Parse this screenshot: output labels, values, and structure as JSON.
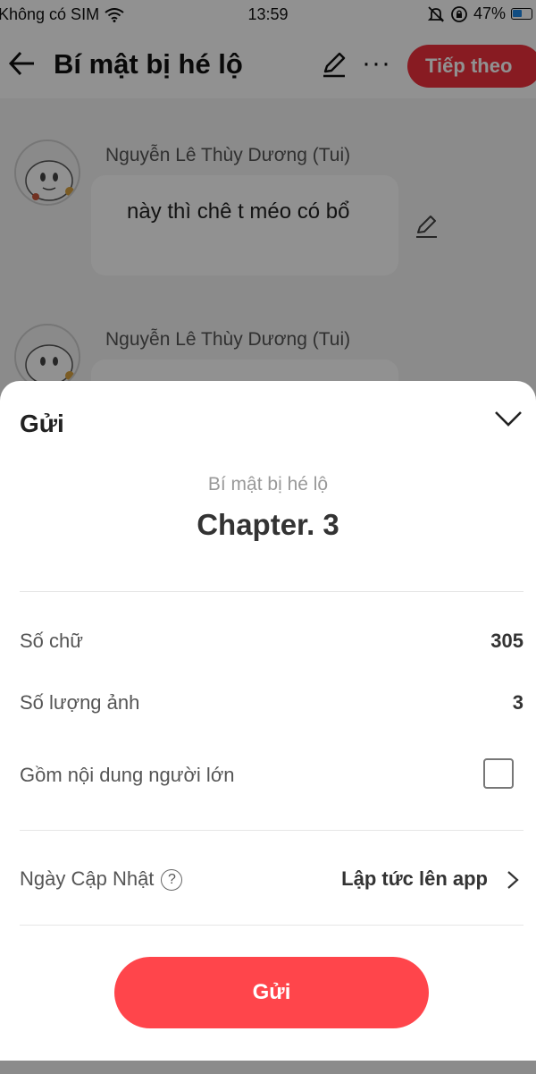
{
  "status_bar": {
    "carrier": "Không có SIM",
    "time": "13:59",
    "battery": "47%"
  },
  "nav": {
    "title": "Bí mật bị hé lộ",
    "more_label": "···",
    "next_label": "Tiếp theo"
  },
  "chat": {
    "messages": [
      {
        "author": "Nguyễn Lê Thùy Dương (Tui)",
        "text": "này thì chê t méo có bổ"
      },
      {
        "author": "Nguyễn Lê Thùy Dương (Tui)",
        "text": ""
      }
    ]
  },
  "sheet": {
    "title": "Gửi",
    "story_name": "Bí mật bị hé lộ",
    "chapter_name": "Chapter. 3",
    "word_count_label": "Số chữ",
    "word_count_value": "305",
    "image_count_label": "Số lượng ảnh",
    "image_count_value": "3",
    "adult_content_label": "Gồm nội dung người lớn",
    "update_date_label": "Ngày Cập Nhật",
    "help_glyph": "?",
    "update_date_value": "Lập tức lên app",
    "submit_label": "Gửi"
  },
  "colors": {
    "accent": "#ff454b",
    "next_button": "#f0303c"
  }
}
